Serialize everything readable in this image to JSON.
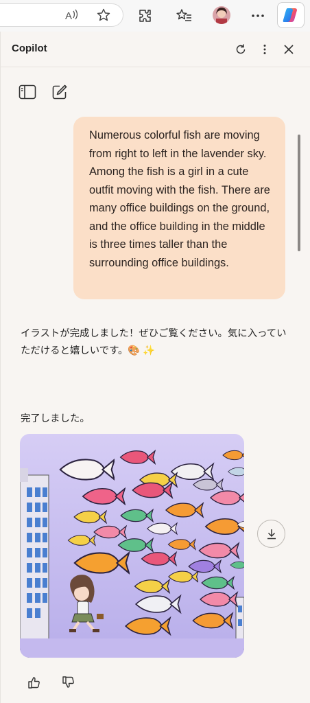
{
  "browser": {
    "icons": [
      "read-aloud-icon",
      "favorite-star-icon",
      "extensions-icon",
      "favorites-icon",
      "profile-avatar",
      "more-icon",
      "copilot-icon"
    ]
  },
  "panel": {
    "title": "Copilot",
    "header_icons": [
      "refresh-icon",
      "more-vert-icon",
      "close-icon"
    ],
    "toolbar_icons": [
      "sidebar-icon",
      "new-chat-icon"
    ]
  },
  "conversation": {
    "user_message": "Numerous colorful fish are moving from right to left in the lavender sky. Among the fish is a girl in a cute outfit moving with the fish. There are many office buildings on the ground, and the office building in the middle is three times taller than the surrounding office buildings.",
    "assistant_reply": "イラストが完成しました！ぜひご覧ください。気に入っていただけると嬉しいです。🎨 ✨",
    "status": "完了しました。",
    "image_icon": "generated-image",
    "download_icon": "download-icon",
    "feedback_icons": [
      "thumbs-up-icon",
      "thumbs-down-icon"
    ]
  },
  "colors": {
    "panel_bg": "#f8f5f2",
    "user_bubble": "#fbdfc8",
    "image_sky": "#c7bdf0"
  }
}
